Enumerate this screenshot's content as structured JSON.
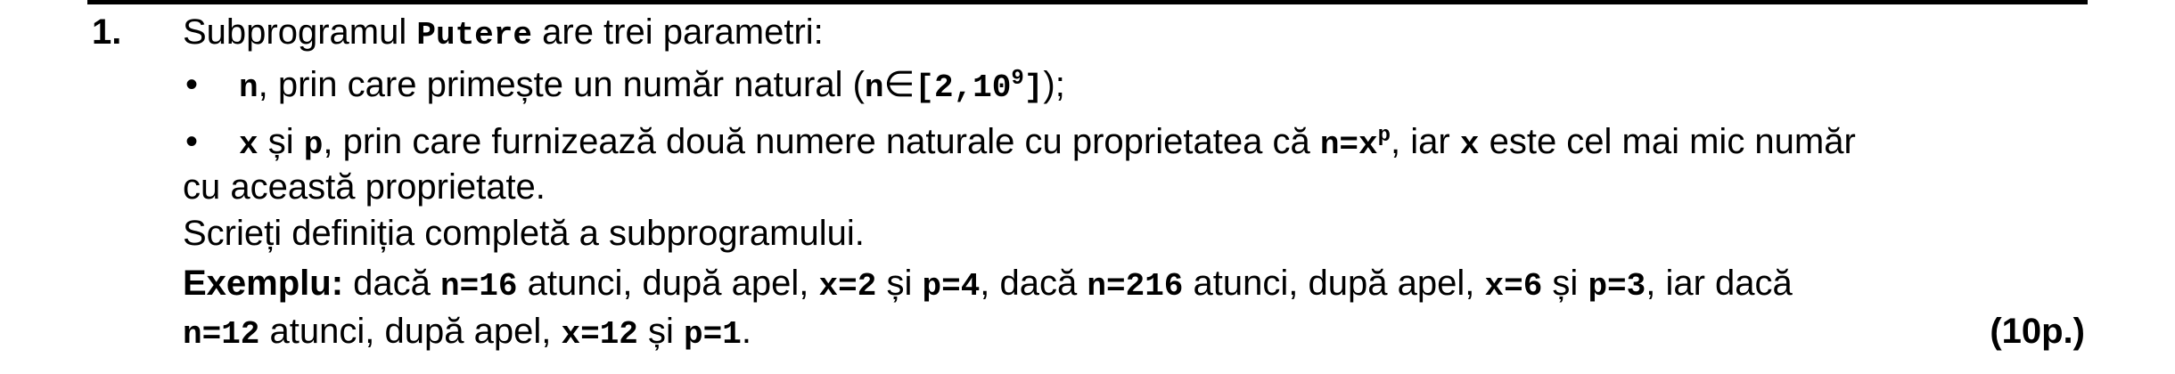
{
  "problem": {
    "number": "1.",
    "intro_text": "Subprogramul",
    "subprogram_name": "Putere",
    "intro_rest": "are trei parametri:",
    "bullets": [
      {
        "symbol": "•",
        "param": "n",
        "text_a": ", prin care primește un număr natural (",
        "param2": "n",
        "set_symbol": "∈",
        "range": "[2,10",
        "range_exp": "9",
        "range_close": "]",
        "text_b": ");"
      },
      {
        "symbol": "•",
        "param_x": "x",
        "text_si": "și",
        "param_p": "p",
        "text_a": ", prin care furnizează două numere naturale cu proprietatea că",
        "formula": "n=x",
        "formula_exp": "p",
        "text_b": ", iar",
        "param_x2": "x",
        "text_c": "este cel mai mic număr",
        "text_continued": "cu această proprietate."
      }
    ],
    "task": "Scrieți definiția completă a subprogramului.",
    "example": {
      "label": "Exemplu:",
      "t1": "dacă",
      "c1": "n=16",
      "t2": "atunci, după apel,",
      "c2": "x=2",
      "t3": "și",
      "c3": "p=4",
      "t4": ", dacă",
      "c4": "n=216",
      "t5": "atunci, după apel,",
      "c5": "x=6",
      "t6": "și",
      "c6": "p=3",
      "t7": ", iar dacă",
      "c7": "n=12",
      "t8": "atunci, după apel,",
      "c8": "x=12",
      "t9": "și",
      "c9": "p=1",
      "t10": "."
    },
    "points": "(10p.)"
  }
}
